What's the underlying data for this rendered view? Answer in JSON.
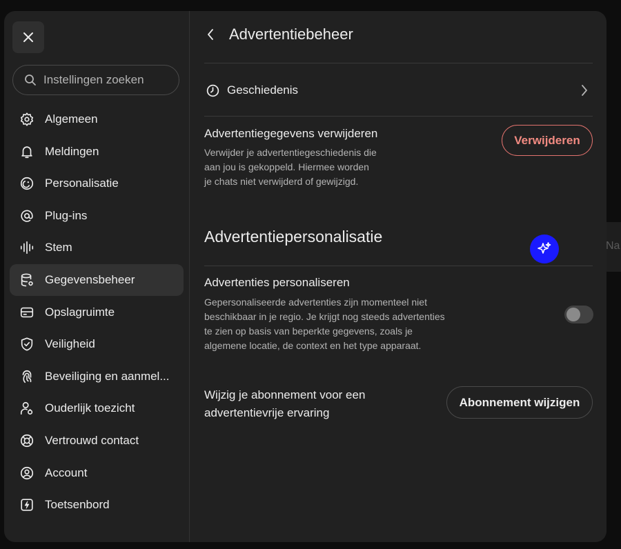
{
  "backdrop": {
    "partial_text": "Na"
  },
  "modal": {
    "close_icon": "close-icon",
    "search": {
      "placeholder": "Instellingen zoeken",
      "value": ""
    },
    "sidebar": {
      "items": [
        {
          "label": "Algemeen",
          "icon": "gear-icon",
          "active": false
        },
        {
          "label": "Meldingen",
          "icon": "bell-icon",
          "active": false
        },
        {
          "label": "Personalisatie",
          "icon": "personalization-icon",
          "active": false
        },
        {
          "label": "Plug-ins",
          "icon": "at-sign-icon",
          "active": false
        },
        {
          "label": "Stem",
          "icon": "waveform-icon",
          "active": false
        },
        {
          "label": "Gegevensbeheer",
          "icon": "database-icon",
          "active": true
        },
        {
          "label": "Opslagruimte",
          "icon": "storage-icon",
          "active": false
        },
        {
          "label": "Veiligheid",
          "icon": "shield-icon",
          "active": false
        },
        {
          "label": "Beveiliging en aanmel...",
          "icon": "fingerprint-icon",
          "active": false
        },
        {
          "label": "Ouderlijk toezicht",
          "icon": "parental-icon",
          "active": false
        },
        {
          "label": "Vertrouwd contact",
          "icon": "lifebuoy-icon",
          "active": false
        },
        {
          "label": "Account",
          "icon": "user-circle-icon",
          "active": false
        },
        {
          "label": "Toetsenbord",
          "icon": "keyboard-icon",
          "active": false
        }
      ]
    },
    "content": {
      "title": "Advertentiebeheer",
      "history": {
        "label": "Geschiedenis"
      },
      "delete_data": {
        "title": "Advertentiegegevens verwijderen",
        "description_lines": [
          "Verwijder je advertentiegeschiedenis die",
          "aan jou is gekoppeld. Hiermee worden",
          "je chats niet verwijderd of gewijzigd."
        ],
        "button_label": "Verwijderen"
      },
      "section_title": "Advertentiepersonalisatie",
      "personalize": {
        "title": "Advertenties personaliseren",
        "description_lines": [
          "Gepersonaliseerde advertenties zijn momenteel niet",
          "beschikbaar in je regio. Je krijgt nog steeds advertenties",
          "te zien op basis van beperkte gegevens, zoals je",
          "algemene locatie, de context en het type apparaat."
        ],
        "toggle_on": false
      },
      "ad_free": {
        "title_lines": [
          "Wijzig je abonnement voor een",
          "advertentievrije ervaring"
        ],
        "button_label": "Abonnement wijzigen"
      }
    }
  },
  "colors": {
    "background": "#0d0d0d",
    "modal": "#212121",
    "active_item": "#323232",
    "danger": "#f28b82",
    "ai_badge": "#1a1aff"
  }
}
